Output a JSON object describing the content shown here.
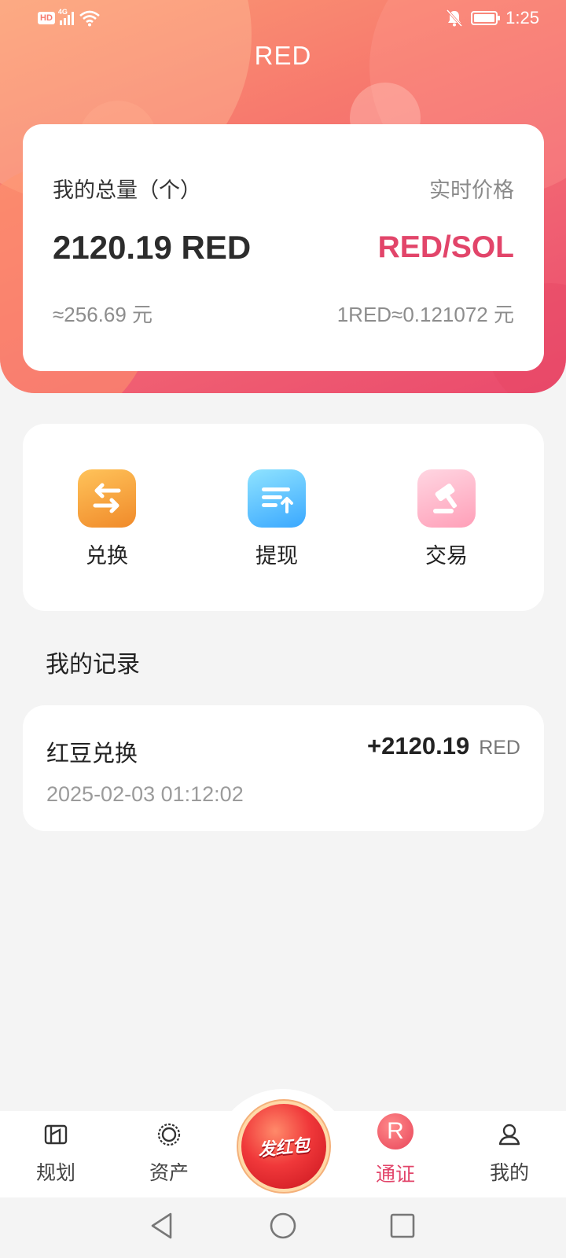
{
  "status_bar": {
    "hd_badge": "HD",
    "network": "4G",
    "time": "1:25",
    "battery_percent": 100
  },
  "header": {
    "title": "RED"
  },
  "balance": {
    "label": "我的总量（个）",
    "price_label": "实时价格",
    "amount": "2120.19 RED",
    "pair": "RED/SOL",
    "approx_value": "≈256.69 元",
    "rate": "1RED≈0.121072 元"
  },
  "actions": [
    {
      "label": "兑换",
      "icon": "exchange-icon",
      "color": "#f5a43a"
    },
    {
      "label": "提现",
      "icon": "withdraw-icon",
      "color": "#4cb6ff"
    },
    {
      "label": "交易",
      "icon": "gavel-icon",
      "color": "#ff9fb8"
    }
  ],
  "records": {
    "title": "我的记录",
    "items": [
      {
        "title": "红豆兑换",
        "amount": "+2120.19",
        "unit": "RED",
        "time": "2025-02-03 01:12:02"
      }
    ]
  },
  "tabbar": {
    "tabs": [
      {
        "label": "规划",
        "icon": "map-icon",
        "active": false
      },
      {
        "label": "资产",
        "icon": "assets-icon",
        "active": false
      },
      {
        "label": "发红包",
        "icon": "red-packet-icon",
        "active": false
      },
      {
        "label": "通证",
        "icon": "token-r-icon",
        "active": true,
        "badge": "R"
      },
      {
        "label": "我的",
        "icon": "profile-icon",
        "active": false
      }
    ],
    "accent": "#e2456a"
  },
  "colors": {
    "brand_red": "#e2456a",
    "hero_start": "#fb9a73",
    "hero_end": "#ea4a6d"
  }
}
